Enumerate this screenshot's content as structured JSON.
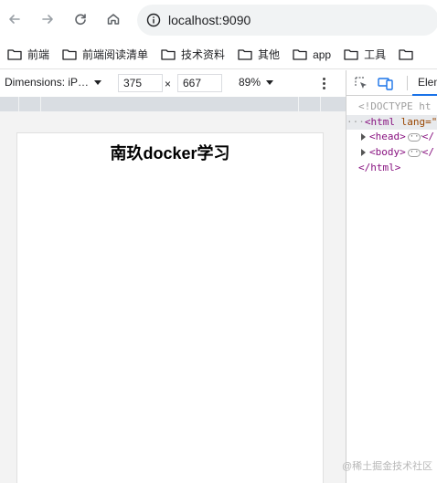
{
  "browser": {
    "url": "localhost:9090"
  },
  "bookmarks": [
    {
      "label": "前端"
    },
    {
      "label": "前端阅读清单"
    },
    {
      "label": "技术资料"
    },
    {
      "label": "其他"
    },
    {
      "label": "app"
    },
    {
      "label": "工具"
    }
  ],
  "device_toolbar": {
    "dimensions_label": "Dimensions: iP…",
    "width_value": "375",
    "times": "×",
    "height_value": "667",
    "zoom_value": "89%"
  },
  "page": {
    "heading": "南玖docker学习"
  },
  "devtools": {
    "active_tab": "Elen",
    "lines": {
      "doctype": "<!DOCTYPE ht",
      "html_open_tag": "<html",
      "html_attr": "lang=\"",
      "head_tag": "<head>",
      "head_close": "</",
      "body_tag": "<body>",
      "body_close": "</",
      "html_close": "</html>"
    }
  },
  "watermark": "@稀土掘金技术社区",
  "colors": {
    "accent": "#1a73e8",
    "tag": "#881280",
    "attr": "#994500"
  }
}
